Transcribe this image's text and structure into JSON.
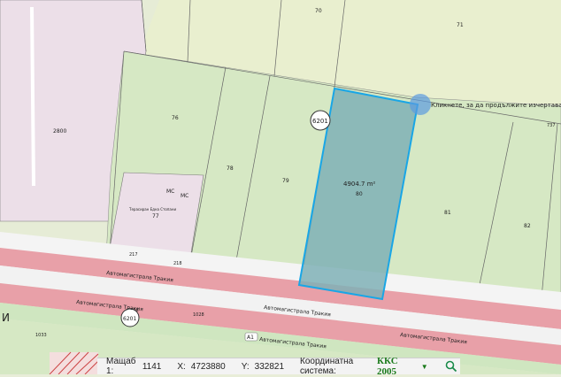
{
  "map": {
    "parcels": {
      "p70": "70",
      "p71": "71",
      "p2800": "2800",
      "p76": "76",
      "p78": "78",
      "p79": "79",
      "p80": "80",
      "p81": "81",
      "p82": "82",
      "p77": "77",
      "p217": "217",
      "p218": "218",
      "p1028a": "1028",
      "p1028b": "1028",
      "p1033": "1033",
      "p737": "737"
    },
    "area_measure": "4904.7 m²",
    "badge_6201_top": "6201",
    "badge_6201_bottom": "6201",
    "badge_a1": "A1",
    "ms_label_1": "МС",
    "ms_label_2": "МС",
    "small_parcel_text": "Терасиран Една Стопани",
    "hint_text": "Кликнете, за да продължите изчертаване на по",
    "road_labels": [
      "Автомагистрала Тракия",
      "Автомагистрала Тракия",
      "Автомагистрала Тракия",
      "Автомагистрала Тракия",
      "Автомагистрала Тракия"
    ],
    "letter_left": "И",
    "colors": {
      "highlight_fill": "#7fb0b6",
      "highlight_stroke": "#19a6e6",
      "road_pink": "#e8a0a8",
      "pink_parcel": "#ecdfe8",
      "agri_green": "#d6e8c4"
    }
  },
  "statusbar": {
    "scale_label": "Мащаб 1:",
    "scale_value": "1141",
    "x_label": "X:",
    "x_value": "4723880",
    "y_label": "Y:",
    "y_value": "332821",
    "crs_label": "Координатна система:",
    "crs_value": "ККС 2005",
    "dropdown_icon": "caret-down",
    "search_icon": "magnifier"
  }
}
